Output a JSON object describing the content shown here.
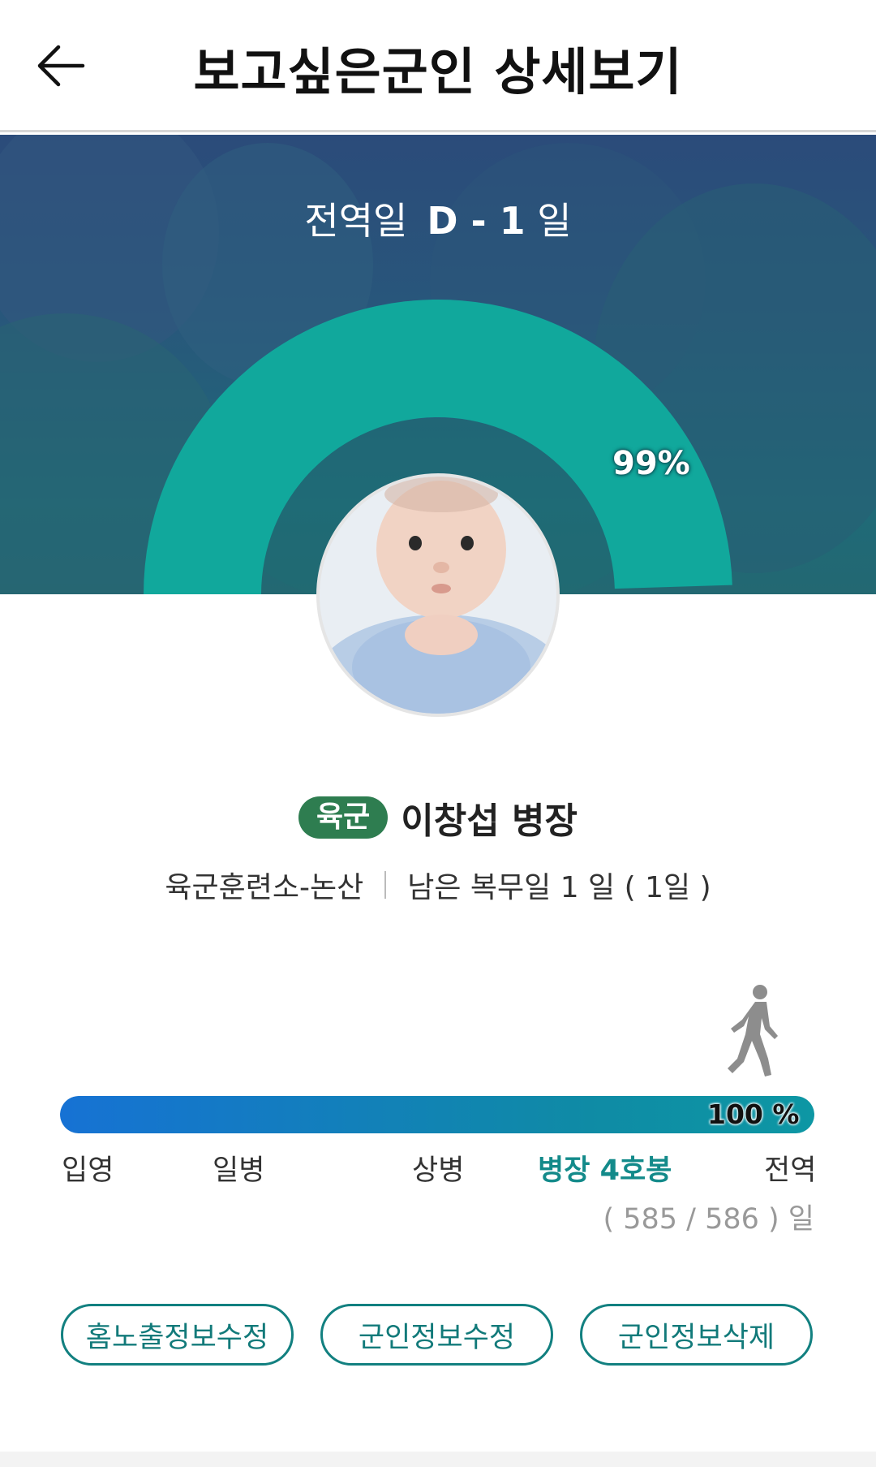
{
  "header": {
    "title": "보고싶은군인 상세보기",
    "back_icon": "arrow-left-icon"
  },
  "hero": {
    "dday_label": "전역일",
    "dday_value": "D - 1",
    "dday_unit": " 일",
    "progress_percent": 99,
    "progress_percent_label": "99%",
    "arc_color": "#11a89c"
  },
  "profile": {
    "branch": "육군",
    "branch_color": "#2e7d50",
    "name_rank": "이창섭 병장",
    "unit": "육군훈련소-논산",
    "remaining": "남은 복무일 1 일 ( 1일 )"
  },
  "service_progress": {
    "percent": 100,
    "percent_label": "100 %",
    "ranks": [
      {
        "label": "입영",
        "active": false
      },
      {
        "label": "일병",
        "active": false
      },
      {
        "label": "상병",
        "active": false
      },
      {
        "label": "병장 4호봉",
        "active": true
      },
      {
        "label": "전역",
        "active": false
      }
    ],
    "days_label": "( 585 / 586 ) 일",
    "walker_icon": "walking-person-icon"
  },
  "actions": {
    "edit_home_info": "홈노출정보수정",
    "edit_soldier_info": "군인정보수정",
    "delete_soldier_info": "군인정보삭제"
  },
  "colors": {
    "accent": "#128080",
    "active_rank": "#138a8a"
  }
}
